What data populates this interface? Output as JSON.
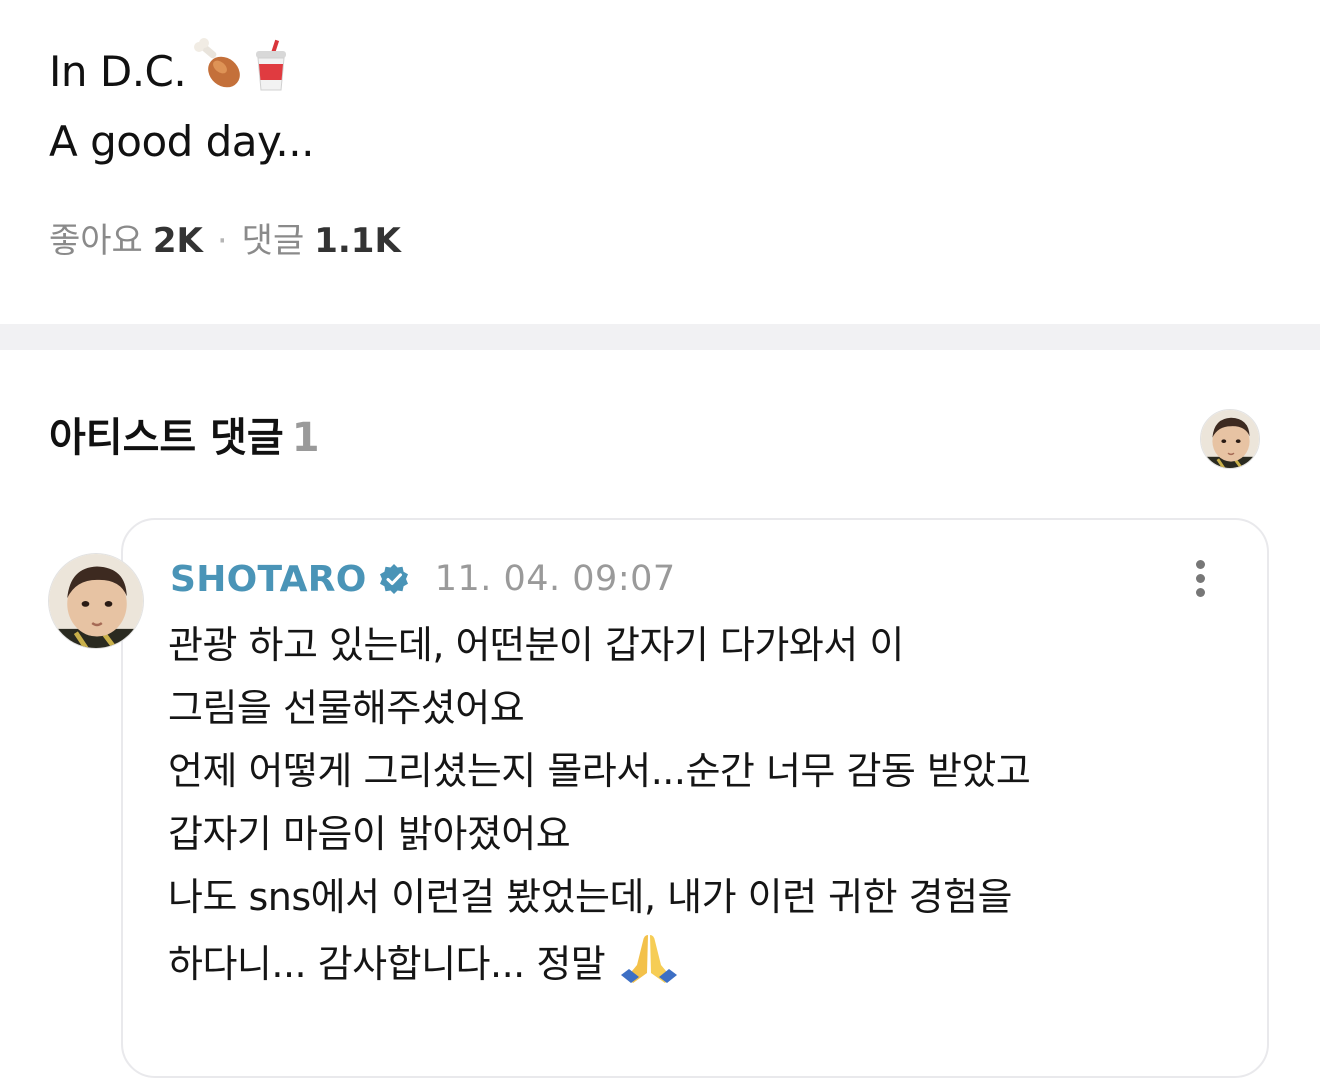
{
  "post": {
    "lines": [
      "In D.C.",
      "A good day..."
    ],
    "emoji_icons": [
      "poultry-leg-icon",
      "cup-with-straw-icon"
    ]
  },
  "stats": {
    "likes_label": "좋아요",
    "likes_value": "2K",
    "separator": "·",
    "comments_label": "댓글",
    "comments_value": "1.1K"
  },
  "artist_comments": {
    "title": "아티스트 댓글",
    "count": "1"
  },
  "comment": {
    "author": "SHOTARO",
    "verified_icon": "verified-badge-icon",
    "timestamp": "11. 04. 09:07",
    "more_icon": "more-vertical-icon",
    "lines": [
      "관광 하고 있는데, 어떤분이 갑자기 다가와서 이",
      "그림을 선물해주셨어요",
      "언제 어떻게 그리셨는지 몰라서...순간 너무 감동 받았고",
      "갑자기 마음이 밝아졌어요",
      "나도 sns에서 이런걸 봤었는데, 내가 이런 귀한 경험을",
      "하다니...  감사합니다... 정말"
    ],
    "trailing_icon": "folded-hands-icon"
  },
  "colors": {
    "author": "#4a94b7",
    "verified": "#4a94b7",
    "divider": "#f1f1f3",
    "muted": "#9a9a9a"
  }
}
